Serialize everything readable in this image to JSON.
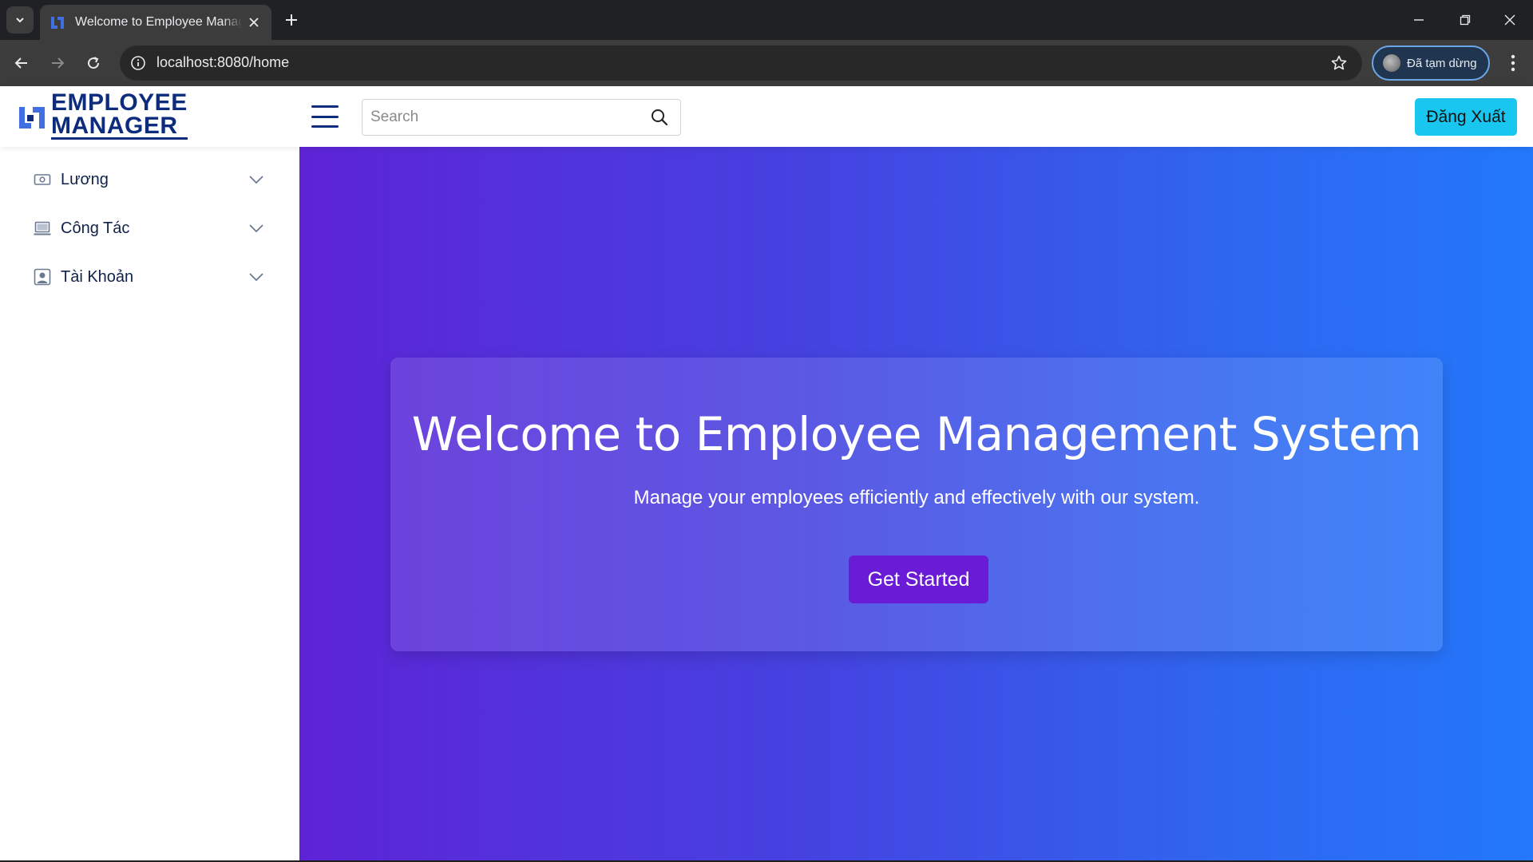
{
  "browser": {
    "tab_title": "Welcome to Employee Management",
    "url": "localhost:8080/home",
    "profile_status": "Đã tạm dừng"
  },
  "header": {
    "logo_line1": "EMPLOYEE",
    "logo_line2": "MANAGER",
    "search_placeholder": "Search",
    "logout_label": "Đăng Xuất"
  },
  "sidebar": {
    "items": [
      {
        "label": "Lương",
        "icon": "money-icon"
      },
      {
        "label": "Công Tác",
        "icon": "laptop-icon"
      },
      {
        "label": "Tài Khoản",
        "icon": "account-icon"
      }
    ]
  },
  "hero": {
    "title": "Welcome to Employee Management System",
    "subtitle": "Manage your employees efficiently and effectively with our system.",
    "cta_label": "Get Started"
  },
  "colors": {
    "brand_navy": "#0d2c7d",
    "logout_bg": "#19c6f0",
    "hero_start": "#5d24d6",
    "hero_end": "#2378fb",
    "cta_bg": "#6a1bd6"
  }
}
